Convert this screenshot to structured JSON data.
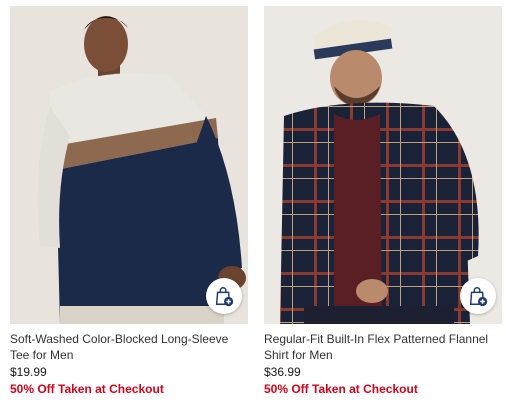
{
  "products": [
    {
      "name": "Soft-Washed Color-Blocked Long-Sleeve Tee for Men",
      "price": "$19.99",
      "promo": "50% Off Taken at Checkout",
      "image_icon": "man-in-color-blocked-tee-photo",
      "bag_icon": "add-to-bag-icon"
    },
    {
      "name": "Regular-Fit Built-In Flex Patterned Flannel Shirt for Men",
      "price": "$36.99",
      "promo": "50% Off Taken at Checkout",
      "image_icon": "man-in-plaid-flannel-photo",
      "bag_icon": "add-to-bag-icon"
    }
  ],
  "colors": {
    "promo": "#d0021b",
    "bag_accent": "#1f3b73"
  }
}
